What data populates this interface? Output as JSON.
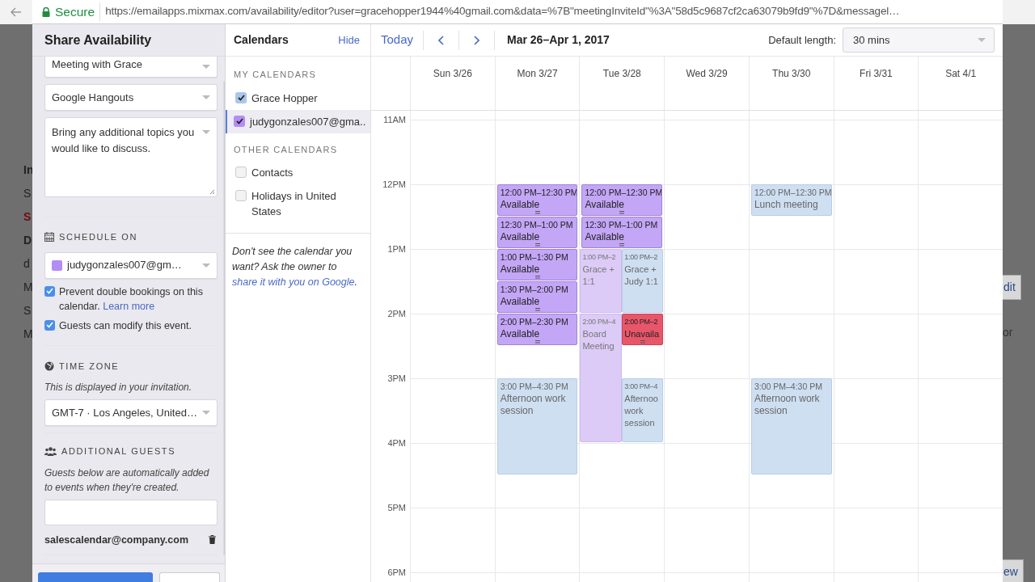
{
  "browser": {
    "secure_label": "Secure",
    "url": "https://emailapps.mixmax.com/availability/editor?user=gracehopper1944%40gmail.com&data=%7B\"meetingInviteId\"%3A\"58d5c9687cf2ca63079b9fd9\"%7D&messagel…"
  },
  "backdrop": {
    "left": [
      {
        "kind": "bold",
        "text": "In"
      },
      {
        "kind": "plain",
        "text": "S"
      },
      {
        "kind": "alert",
        "text": "S"
      },
      {
        "kind": "bold",
        "text": "D"
      },
      {
        "kind": "plain",
        "text": "d"
      },
      {
        "kind": "plain",
        "text": "M"
      },
      {
        "kind": "plain",
        "text": "S"
      },
      {
        "kind": "plain",
        "text": "M"
      }
    ],
    "right": [
      {
        "kind": "button",
        "text": "dit"
      },
      {
        "kind": "plain",
        "text": "or"
      },
      {
        "kind": "button",
        "text": "ew"
      }
    ]
  },
  "panel": {
    "title": "Share Availability",
    "fields": [
      {
        "kind": "select",
        "value": "Meeting with Grace"
      },
      {
        "kind": "select",
        "value": "Google Hangouts"
      },
      {
        "kind": "textarea",
        "value": "Bring any additional topics you would like to discuss."
      }
    ],
    "schedule": {
      "heading": "SCHEDULE ON",
      "calendar": "judygonzales007@gm…",
      "color": "#b48cf5",
      "options": [
        {
          "label": "Prevent double bookings on this calendar.",
          "link": "Learn more",
          "checked": true
        },
        {
          "label": "Guests can modify this event.",
          "checked": true
        }
      ]
    },
    "time_zone": {
      "heading": "TIME ZONE",
      "note": "This is displayed in your invitation.",
      "value": "GMT-7 · Los Angeles, United…"
    },
    "guests": {
      "heading": "ADDITIONAL GUESTS",
      "note": "Guests below are automatically added to events when they're created.",
      "list": [
        "salescalendar@company.com"
      ]
    }
  },
  "calendars": {
    "title": "Calendars",
    "hide": "Hide",
    "groups": [
      {
        "heading": "MY CALENDARS",
        "items": [
          {
            "label": "Grace Hopper",
            "checked": true,
            "selected": false,
            "color": "#a9c7ea"
          },
          {
            "label": "judygonzales007@gma..",
            "checked": true,
            "selected": true,
            "color": "#b48cf5"
          }
        ]
      },
      {
        "heading": "OTHER CALENDARS",
        "items": [
          {
            "label": "Contacts",
            "checked": false,
            "selected": false
          },
          {
            "label": "Holidays in United States",
            "checked": false,
            "selected": false
          }
        ]
      }
    ],
    "help": "Don't see the calendar you want? Ask the owner to",
    "help_link": "share it with you on Google",
    "help_end": "."
  },
  "toolbar": {
    "today": "Today",
    "range": "Mar 26–Apr 1, 2017",
    "default_length_label": "Default length:",
    "default_length": "30 mins"
  },
  "hours": [
    "11AM",
    "12PM",
    "1PM",
    "2PM",
    "3PM",
    "4PM",
    "5PM",
    "6PM"
  ],
  "days": [
    {
      "label": "Sun 3/26"
    },
    {
      "label": "Mon 3/27",
      "events": [
        {
          "kind": "available",
          "time": "12:00 PM–12:30 PM",
          "title": "Available"
        },
        {
          "kind": "available",
          "time": "12:30 PM–1:00 PM",
          "title": "Available"
        },
        {
          "kind": "available",
          "time": "1:00 PM–1:30 PM",
          "title": "Available"
        },
        {
          "kind": "available",
          "time": "1:30 PM–2:00 PM",
          "title": "Available"
        },
        {
          "kind": "available",
          "time": "2:00 PM–2:30 PM",
          "title": "Available"
        },
        {
          "kind": "busy",
          "time": "3:00 PM–4:30 PM",
          "title": "Afternoon work session"
        }
      ]
    },
    {
      "label": "Tue 3/28",
      "events": [
        {
          "kind": "available",
          "time": "12:00 PM–12:30 PM",
          "title": "Available"
        },
        {
          "kind": "available",
          "time": "12:30 PM–1:00 PM",
          "title": "Available"
        },
        {
          "kind": "shared",
          "time": "1:00 PM–2",
          "title": "Grace + 1:1"
        },
        {
          "kind": "shared",
          "time": "2:00 PM–4",
          "title": "Board Meeting"
        },
        {
          "kind": "busy",
          "time": "1:00 PM–2",
          "title": "Grace + Judy 1:1"
        },
        {
          "kind": "unavailable",
          "time": "2:00 PM–2",
          "title": "Unavaila"
        },
        {
          "kind": "busy",
          "time": "3:00 PM–4",
          "title": "Afternoo work session"
        }
      ]
    },
    {
      "label": "Wed 3/29"
    },
    {
      "label": "Thu 3/30",
      "events": [
        {
          "kind": "busy",
          "time": "12:00 PM–12:30 PM",
          "title": "Lunch meeting"
        },
        {
          "kind": "busy",
          "time": "3:00 PM–4:30 PM",
          "title": "Afternoon work session"
        }
      ]
    },
    {
      "label": "Fri 3/31"
    },
    {
      "label": "Sat 4/1"
    }
  ]
}
